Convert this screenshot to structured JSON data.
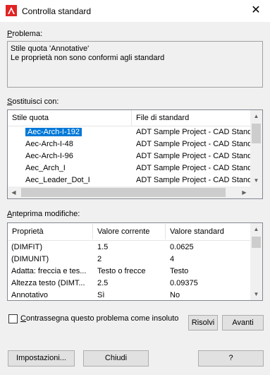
{
  "window": {
    "title": "Controlla standard",
    "close_glyph": "✕"
  },
  "problem": {
    "label": "Problema:",
    "lines": [
      "Stile quota 'Annotative'",
      "Le proprietà non sono conformi agli standard"
    ]
  },
  "replace": {
    "label": "Sostituisci con:",
    "columns": [
      "Stile quota",
      "File di standard"
    ],
    "rows": [
      {
        "name": "Aec-Arch-I-192",
        "file": "ADT Sample Project - CAD Standa",
        "selected": true
      },
      {
        "name": "Aec-Arch-I-48",
        "file": "ADT Sample Project - CAD Standa"
      },
      {
        "name": "Aec-Arch-I-96",
        "file": "ADT Sample Project - CAD Standa"
      },
      {
        "name": "Aec_Arch_I",
        "file": "ADT Sample Project - CAD Standa"
      },
      {
        "name": "Aec_Leader_Dot_I",
        "file": "ADT Sample Project - CAD Standa"
      }
    ]
  },
  "preview": {
    "label": "Anteprima modifiche:",
    "columns": [
      "Proprietà",
      "Valore corrente",
      "Valore standard"
    ],
    "rows": [
      {
        "prop": "(DIMFIT)",
        "current": "1.5",
        "standard": "0.0625"
      },
      {
        "prop": "(DIMUNIT)",
        "current": "2",
        "standard": "4"
      },
      {
        "prop": "Adatta: freccia e tes...",
        "current": "Testo o frecce",
        "standard": "Testo"
      },
      {
        "prop": "Altezza testo (DIMT...",
        "current": "2.5",
        "standard": "0.09375"
      },
      {
        "prop": "Annotativo",
        "current": "Sì",
        "standard": "No"
      }
    ]
  },
  "footer": {
    "ignore_label": "Contrassegna questo problema come insoluto",
    "fix_button": "Risolvi",
    "next_button": "Avanti",
    "settings_button": "Impostazioni...",
    "close_button": "Chiudi",
    "help_button": "?"
  },
  "colors": {
    "selection": "#0078d7",
    "app_icon": "#e02424"
  },
  "icons": {
    "app": "autocad-icon",
    "close": "close-icon"
  }
}
